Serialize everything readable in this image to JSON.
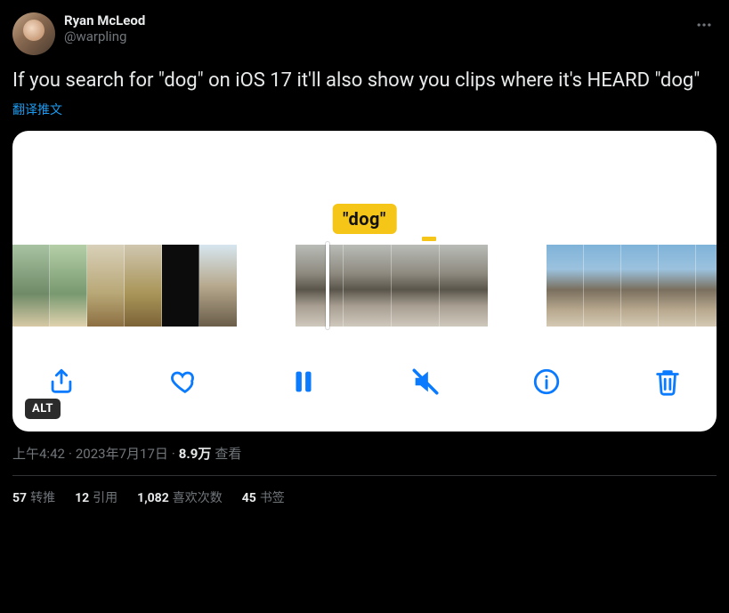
{
  "author": {
    "display_name": "Ryan McLeod",
    "handle": "@warpling"
  },
  "tweet_text": "If you search for \"dog\" on iOS 17 it'll also show you clips where it's HEARD \"dog\"",
  "translate_label": "翻译推文",
  "media": {
    "tag_text": "\"dog\"",
    "alt_badge": "ALT"
  },
  "meta": {
    "time": "上午4:42",
    "separator": " · ",
    "date": "2023年7月17日",
    "views_count": "8.9万",
    "views_label": " 查看"
  },
  "stats": {
    "retweets": {
      "count": "57",
      "label": "转推"
    },
    "quotes": {
      "count": "12",
      "label": "引用"
    },
    "likes": {
      "count": "1,082",
      "label": "喜欢次数"
    },
    "bookmarks": {
      "count": "45",
      "label": "书签"
    }
  }
}
